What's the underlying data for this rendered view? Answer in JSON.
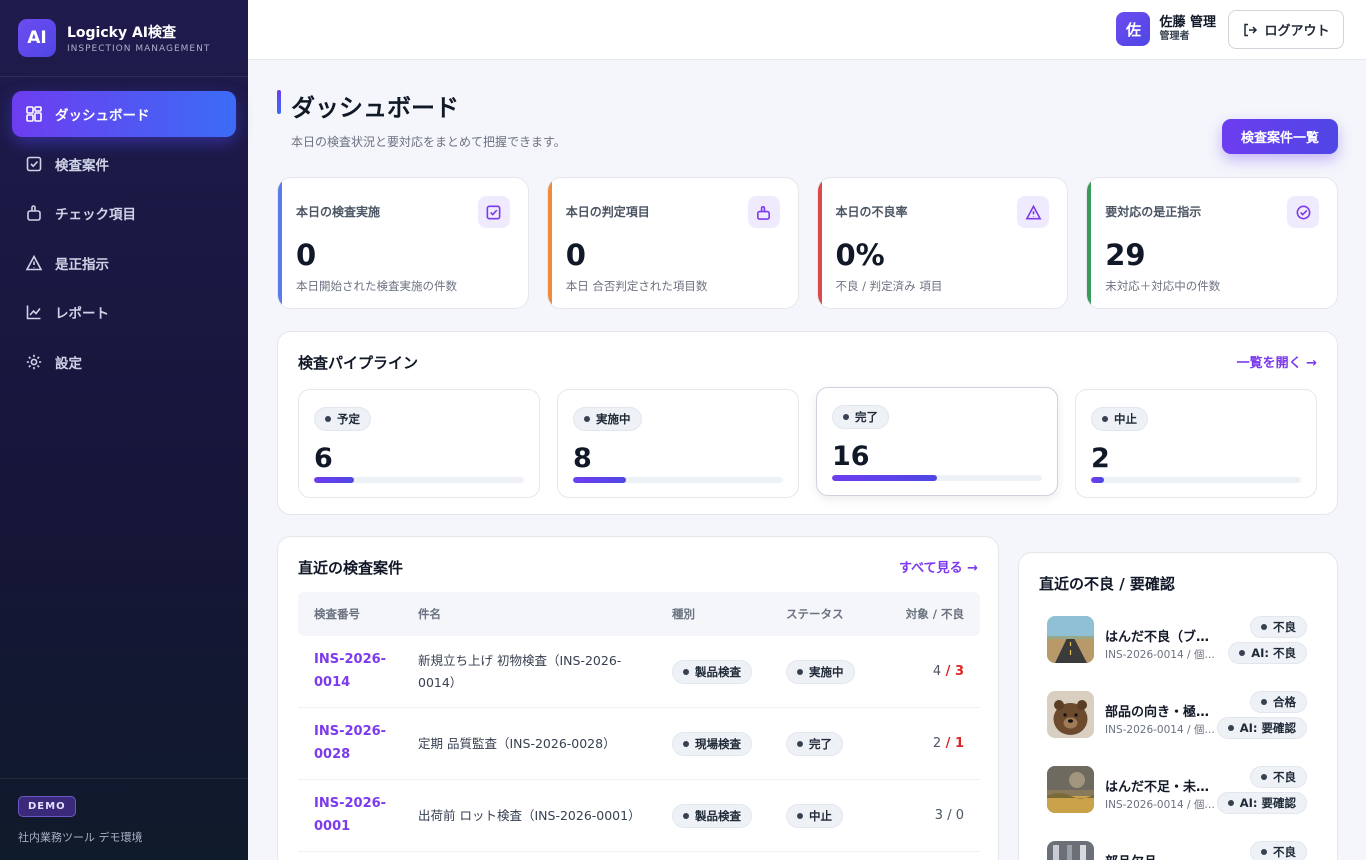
{
  "brand": {
    "logo": "AI",
    "title": "Logicky AI検査",
    "subtitle": "INSPECTION MANAGEMENT"
  },
  "sidebar": {
    "items": [
      {
        "label": "ダッシュボード",
        "icon": "dashboard-icon",
        "active": true
      },
      {
        "label": "検査案件",
        "icon": "checkbox-icon"
      },
      {
        "label": "チェック項目",
        "icon": "clipboard-icon"
      },
      {
        "label": "是正指示",
        "icon": "warning-icon"
      },
      {
        "label": "レポート",
        "icon": "chart-icon"
      },
      {
        "label": "設定",
        "icon": "gear-icon"
      }
    ],
    "footer": {
      "badge": "DEMO",
      "text": "社内業務ツール デモ環境"
    }
  },
  "topbar": {
    "user": {
      "avatar": "佐",
      "name": "佐藤 管理",
      "role": "管理者"
    },
    "logout_label": "ログアウト"
  },
  "page": {
    "title": "ダッシュボード",
    "subtitle": "本日の検査状況と要対応をまとめて把握できます。",
    "primary_button": "検査案件一覧"
  },
  "stats": [
    {
      "label": "本日の検査実施",
      "value": "0",
      "note": "本日開始された検査実施の件数",
      "color": "#5b7be8",
      "icon": "checkbox-icon"
    },
    {
      "label": "本日の判定項目",
      "value": "0",
      "note": "本日 合否判定された項目数",
      "color": "#f08a3c",
      "icon": "thumbs-up-icon"
    },
    {
      "label": "本日の不良率",
      "value": "0%",
      "note": "不良 / 判定済み 項目",
      "color": "#d94a4a",
      "icon": "warning-icon"
    },
    {
      "label": "要対応の是正指示",
      "value": "29",
      "note": "未対応＋対応中の件数",
      "color": "#3a9a5b",
      "icon": "check-circle-icon"
    }
  ],
  "pipeline": {
    "title": "検査パイプライン",
    "link": "一覧を開く →",
    "stages": [
      {
        "label": "予定",
        "value": "6",
        "fill": 0.19
      },
      {
        "label": "実施中",
        "value": "8",
        "fill": 0.25
      },
      {
        "label": "完了",
        "value": "16",
        "fill": 0.5
      },
      {
        "label": "中止",
        "value": "2",
        "fill": 0.06
      }
    ]
  },
  "recent": {
    "title": "直近の検査案件",
    "link": "すべて見る →",
    "columns": [
      "検査番号",
      "件名",
      "種別",
      "ステータス",
      "対象 / 不良"
    ],
    "rows": [
      {
        "id": "INS-2026-0014",
        "name": "新規立ち上げ 初物検査（INS-2026-0014）",
        "type": "製品検査",
        "status": "実施中",
        "target": "4",
        "defect": "3"
      },
      {
        "id": "INS-2026-0028",
        "name": "定期 品質監査（INS-2026-0028）",
        "type": "現場検査",
        "status": "完了",
        "target": "2",
        "defect": "1"
      },
      {
        "id": "INS-2026-0001",
        "name": "出荷前 ロット検査（INS-2026-0001）",
        "type": "製品検査",
        "status": "中止",
        "target": "3",
        "defect": "0"
      }
    ],
    "separator": " / "
  },
  "defects": {
    "title": "直近の不良 / 要確認",
    "items": [
      {
        "title": "はんだ不良（ブ…",
        "sub": "INS-2026-0014 / 個体…",
        "result": "不良",
        "ai": "AI: 不良",
        "thumb": "road-photo"
      },
      {
        "title": "部品の向き・極…",
        "sub": "INS-2026-0014 / 個…",
        "result": "合格",
        "ai": "AI: 要確認",
        "thumb": "bear-photo"
      },
      {
        "title": "はんだ不足・未…",
        "sub": "INS-2026-0014 / 個…",
        "result": "不良",
        "ai": "AI: 要確認",
        "thumb": "landscape-photo"
      },
      {
        "title": "部品欠品",
        "sub": "",
        "result": "不良",
        "ai": "",
        "thumb": "machine-photo"
      }
    ]
  }
}
